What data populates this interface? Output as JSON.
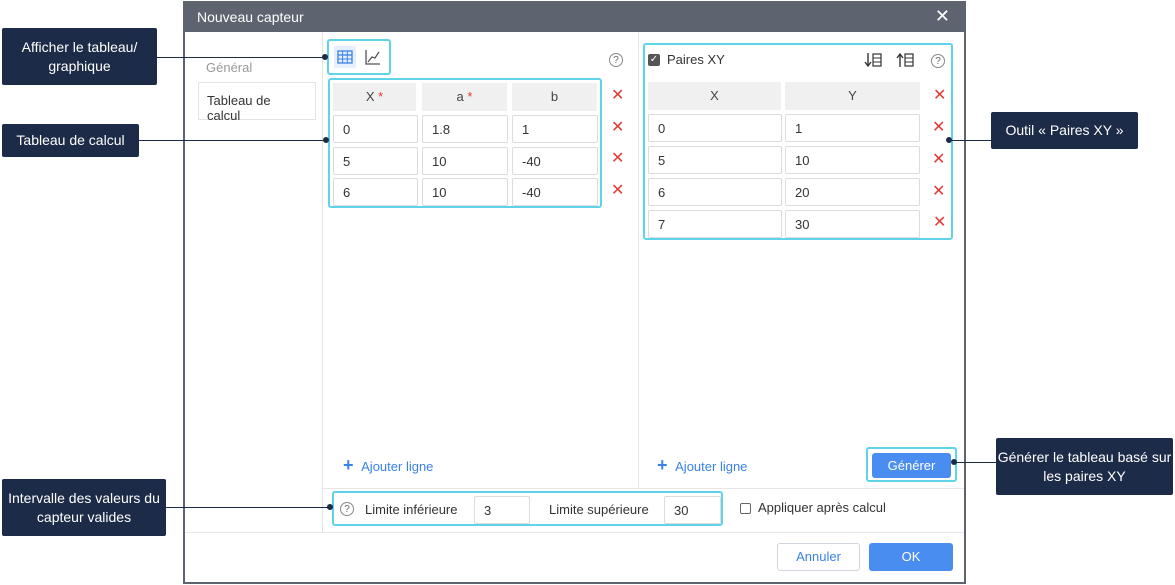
{
  "dialog": {
    "title": "Nouveau capteur",
    "close_glyph": "✕"
  },
  "sidebar": {
    "items": [
      {
        "label": "Général"
      },
      {
        "label": "Tableau de calcul"
      }
    ]
  },
  "calc_table": {
    "headers": {
      "x": "X",
      "a": "a",
      "b": "b",
      "required_mark": "*"
    },
    "rows": [
      {
        "x": "0",
        "a": "1.8",
        "b": "1"
      },
      {
        "x": "5",
        "a": "10",
        "b": "-40"
      },
      {
        "x": "6",
        "a": "10",
        "b": "-40"
      }
    ],
    "add_row_label": "Ajouter ligne",
    "help_glyph": "?"
  },
  "xy_pairs": {
    "checkbox_label": "Paires XY",
    "checked": true,
    "headers": {
      "x": "X",
      "y": "Y"
    },
    "rows": [
      {
        "x": "0",
        "y": "1"
      },
      {
        "x": "5",
        "y": "10"
      },
      {
        "x": "6",
        "y": "20"
      },
      {
        "x": "7",
        "y": "30"
      }
    ],
    "add_row_label": "Ajouter ligne",
    "generate_label": "Générer",
    "help_glyph": "?"
  },
  "limits": {
    "lower_label": "Limite inférieure",
    "lower_value": "3",
    "upper_label": "Limite supérieure",
    "upper_value": "30",
    "apply_after_label": "Appliquer après calcul",
    "apply_after_checked": false,
    "help_glyph": "?"
  },
  "footer": {
    "cancel_label": "Annuler",
    "ok_label": "OK"
  },
  "annotations": {
    "toggle_view": "Afficher le tableau/ graphique",
    "calc_table": "Tableau de calcul",
    "xy_tool": "Outil « Paires XY »",
    "generate": "Générer le tableau basé sur les paires XY",
    "valid_range": "Intervalle des valeurs du capteur valides"
  },
  "colors": {
    "titlebar": "#5d6470",
    "accent": "#4a8df0",
    "highlight": "#5fd3e8",
    "annotation_bg": "#1c2b47",
    "delete": "#e53935"
  }
}
